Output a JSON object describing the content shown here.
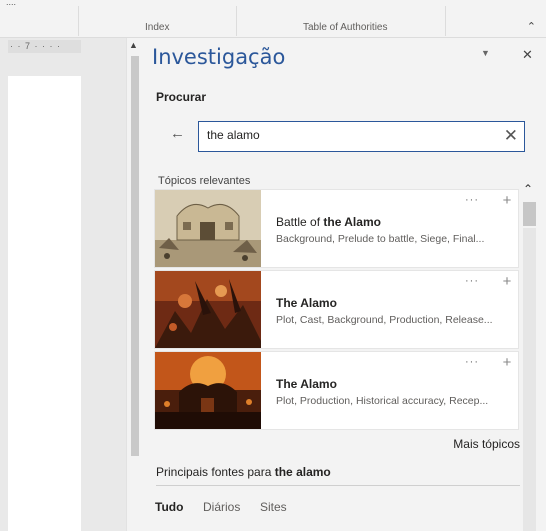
{
  "ribbon": {
    "cut_text": "....",
    "group_index": "Index",
    "group_toa": "Table of Authorities",
    "collapse_icon": "chevron-up-icon"
  },
  "document": {
    "ruler_text": "· · 7 · · · ·"
  },
  "pane": {
    "title": "Investigação",
    "search_heading": "Procurar",
    "search": {
      "value": "the alamo"
    },
    "topics_label": "Tópicos relevantes",
    "cards": [
      {
        "title_prefix": "Battle of ",
        "title_bold": "the Alamo",
        "subtitle": "Background, Prelude to battle, Siege, Final..."
      },
      {
        "title_prefix": "",
        "title_bold": "The Alamo",
        "subtitle": "Plot, Cast, Background, Production, Release..."
      },
      {
        "title_prefix": "",
        "title_bold": "The Alamo",
        "subtitle": "Plot, Production, Historical accuracy, Recep..."
      }
    ],
    "more_icon_text": "···",
    "add_icon_text": "+",
    "more_topics": "Mais tópicos",
    "sources_heading_prefix": "Principais fontes para ",
    "sources_heading_bold": "the alamo",
    "tabs": [
      "Tudo",
      "Diários",
      "Sites"
    ]
  },
  "colors": {
    "accent": "#2b579a",
    "background": "#f3f3f3"
  }
}
